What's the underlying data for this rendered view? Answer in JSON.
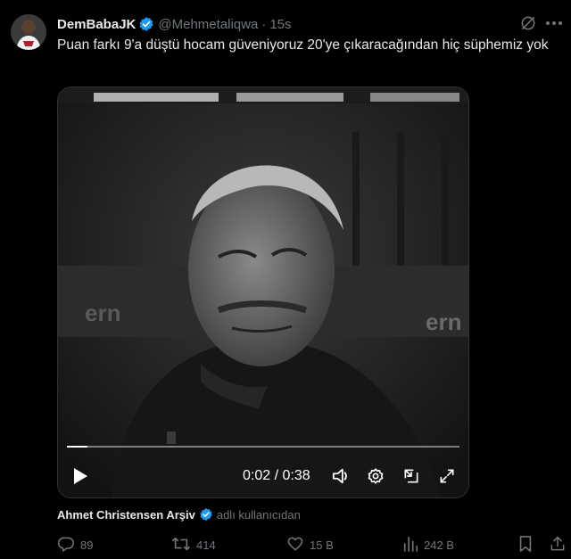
{
  "tweet": {
    "display_name": "DemBabaJK",
    "handle": "@Mehmetaliqwa",
    "separator": "·",
    "time": "15s",
    "text": "Puan farkı 9'a düştü hocam güveniyoruz 20'ye çıkaracağından hiç süphemiz yok",
    "verified": true,
    "accent_color": "#1d9bf0"
  },
  "video": {
    "timecode": "0:02 / 0:38",
    "progress_fraction": 0.053
  },
  "attribution": {
    "name": "Ahmet Christensen Arşiv",
    "suffix": "adlı kullanıcıdan"
  },
  "actions": {
    "replies": "89",
    "retweets": "414",
    "likes": "15 B",
    "views": "242 B"
  },
  "icons": [
    "grok-icon",
    "more-icon",
    "play-icon",
    "volume-icon",
    "settings-icon",
    "pip-icon",
    "fullscreen-icon",
    "reply-icon",
    "retweet-icon",
    "like-icon",
    "views-icon",
    "bookmark-icon",
    "share-icon"
  ]
}
